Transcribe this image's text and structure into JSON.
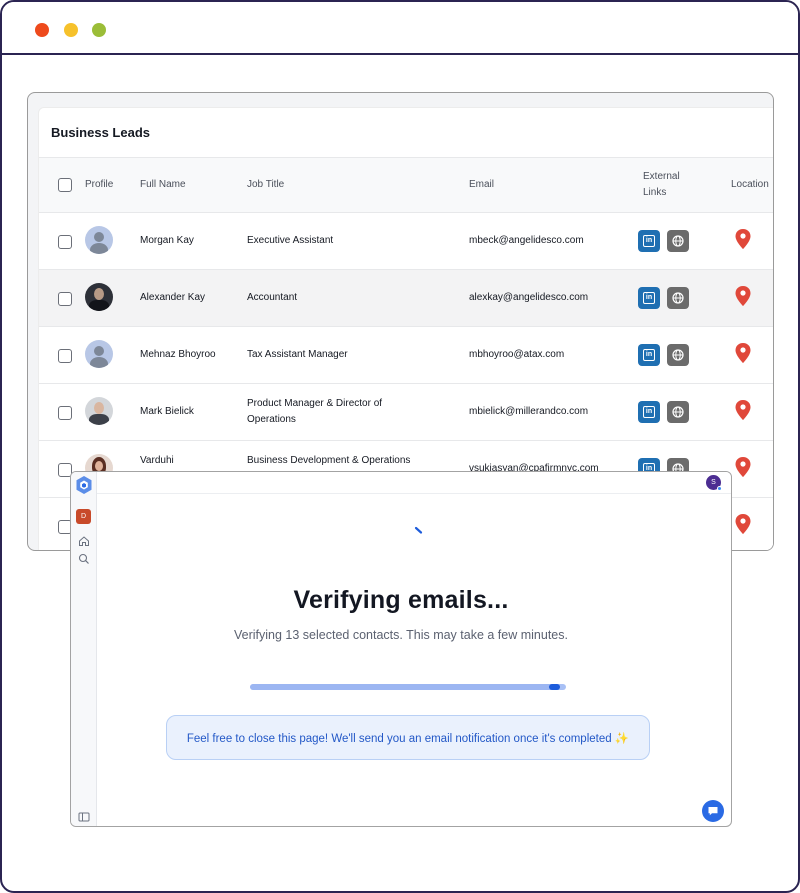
{
  "window": {
    "controls": [
      "close",
      "minimize",
      "maximize"
    ],
    "control_colors": {
      "close": "#ee4a1c",
      "minimize": "#f6c12b",
      "maximize": "#9bbd38"
    }
  },
  "leads": {
    "title": "Business Leads",
    "columns": {
      "profile": "Profile",
      "full_name": "Full Name",
      "job_title": "Job Title",
      "email": "Email",
      "external_links_1": "External",
      "external_links_2": "Links",
      "location": "Location"
    },
    "rows": [
      {
        "name": "Morgan Kay",
        "title_1": "Executive Assistant",
        "title_2": "",
        "email": "mbeck@angelidesco.com",
        "avatar": "default-avatar"
      },
      {
        "name": "Alexander Kay",
        "title_1": "Accountant",
        "title_2": "",
        "email": "alexkay@angelidesco.com",
        "avatar": "photo"
      },
      {
        "name": "Mehnaz Bhoyroo",
        "title_1": "Tax Assistant Manager",
        "title_2": "",
        "email": "mbhoyroo@atax.com",
        "avatar": "default-avatar"
      },
      {
        "name": "Mark Bielick",
        "title_1": "Product Manager & Director of",
        "title_2": "Operations",
        "email": "mbielick@millerandco.com",
        "avatar": "photo"
      },
      {
        "name": "Varduhi",
        "title_1": "Business Development & Operations",
        "title_2": "",
        "email": "vsukiasyan@cpafirmnyc.com",
        "avatar": "photo"
      }
    ],
    "icons": {
      "linkedin": "linkedin-icon",
      "website": "globe-icon",
      "location": "map-pin-icon"
    },
    "colors": {
      "linkedin": "#1f6fb2",
      "website": "#6b6b6b",
      "pin": "#e0483a"
    }
  },
  "app": {
    "workspace_badge": "D",
    "user_initial": "S",
    "verify_title": "Verifying emails...",
    "verify_subtitle": "Verifying 13 selected contacts. This may take a few minutes.",
    "progress_fraction": 0.98,
    "banner_text": "Feel free to close this page! We'll send you an email notification once it's completed ✨",
    "accent": "#2a6ae4"
  }
}
